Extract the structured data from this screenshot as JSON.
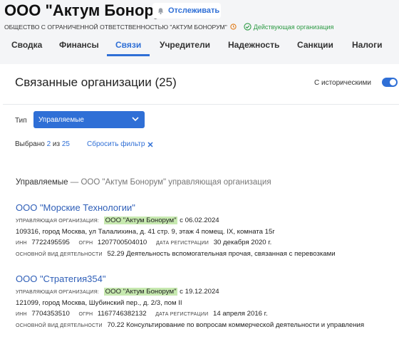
{
  "header": {
    "company_name": "ООО \"Актум Бонорум\"",
    "follow_label": "Отслеживать",
    "legal_name": "ОБЩЕСТВО С ОГРАНИЧЕННОЙ ОТВЕТСТВЕННОСТЬЮ \"АКТУМ БОНОРУМ\"",
    "status_text": "Действующая организация"
  },
  "tabs": [
    {
      "label": "Сводка"
    },
    {
      "label": "Финансы"
    },
    {
      "label": "Связи"
    },
    {
      "label": "Учредители"
    },
    {
      "label": "Надежность"
    },
    {
      "label": "Санкции"
    },
    {
      "label": "Налоги"
    }
  ],
  "card": {
    "title": "Связанные организации (25)",
    "historical_label": "С историческими",
    "type_label": "Тип",
    "type_value": "Управляемые",
    "selected_prefix": "Выбрано",
    "selected_count": "2",
    "selected_of": "из",
    "selected_total": "25",
    "reset_label": "Сбросить фильтр"
  },
  "section": {
    "title": "Управляемые",
    "subtitle": "— ООО \"Актум Бонорум\" управляющая организация"
  },
  "labels": {
    "managing": "УПРАВЛЯЮЩАЯ ОРГАНИЗАЦИЯ:",
    "inn": "ИНН",
    "ogrn": "ОГРН",
    "reg_date": "ДАТА РЕГИСТРАЦИИ",
    "main_activity": "ОСНОВНОЙ ВИД ДЕЯТЕЛЬНОСТИ"
  },
  "orgs": [
    {
      "name": "ООО \"Морские Технологии\"",
      "managing_org": "ООО \"Актум Бонорум\"",
      "managing_since": "с 06.02.2024",
      "address": "109316, город Москва, ул Талалихина, д. 41 стр. 9, этаж 4 помещ. IX, комната 15г",
      "inn": "7722495595",
      "ogrn": "1207700504010",
      "reg_date": "30 декабря 2020 г.",
      "activity": "52.29 Деятельность вспомогательная прочая, связанная с перевозками"
    },
    {
      "name": "ООО \"Стратегия354\"",
      "managing_org": "ООО \"Актум Бонорум\"",
      "managing_since": "с 19.12.2024",
      "address": "121099, город Москва, Шубинский пер., д. 2/3, пом II",
      "inn": "7704353510",
      "ogrn": "1167746382132",
      "reg_date": "14 апреля 2016 г.",
      "activity": "70.22 Консультирование по вопросам коммерческой деятельности и управления"
    }
  ],
  "colors": {
    "accent": "#2f6fd6",
    "status_green": "#2e9b45",
    "highlight": "#c7e9b0"
  },
  "icons": {
    "follow": "bell-icon",
    "clock": "clock-icon",
    "status": "check-circle-icon",
    "select": "chevron-down-icon",
    "reset": "close-icon"
  }
}
